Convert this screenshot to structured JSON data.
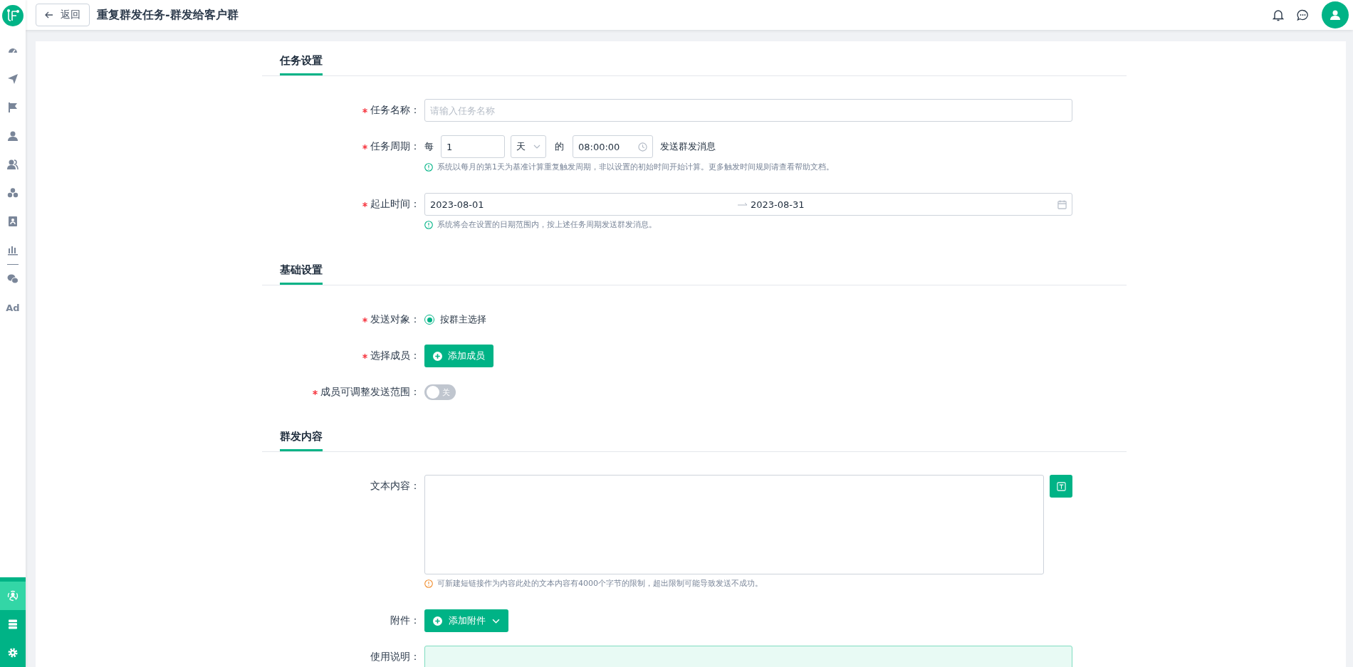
{
  "sidebar": {
    "ad_label": "Ad",
    "bottom_items": [
      {
        "selected": true
      },
      {
        "selected": false
      },
      {
        "selected": false
      }
    ]
  },
  "header": {
    "back_button": "返回",
    "title": "重复群发任务-群发给客户群"
  },
  "sections": [
    {
      "title": "任务设置",
      "fields": [
        {
          "kind": "text",
          "label": "任务名称：",
          "required": true,
          "placeholder": "请输入任务名称"
        },
        {
          "kind": "period",
          "label": "任务周期：",
          "required": true,
          "prefix": "每",
          "count": "1",
          "unit": "天",
          "joiner": "的",
          "time": "08:00:00",
          "suffix": "发送群发消息",
          "hint": {
            "text": "系统以每月的第1天为基准计算重复触发周期，非以设置的初始时间开始计算。更多触发时间规则请查看帮助文档。",
            "kind": "info"
          }
        },
        {
          "kind": "daterange",
          "label": "起止时间：",
          "required": true,
          "start": "2023-08-01",
          "end": "2023-08-31",
          "hint": {
            "text": "系统将会在设置的日期范围内，按上述任务周期发送群发消息。",
            "kind": "info"
          }
        }
      ]
    },
    {
      "title": "基础设置",
      "fields": [
        {
          "kind": "radio",
          "label": "发送对象：",
          "required": true,
          "option": {
            "label": "按群主选择",
            "selected": true
          }
        },
        {
          "kind": "button",
          "label": "选择成员：",
          "required": true,
          "button": "添加成员"
        },
        {
          "kind": "switch",
          "label": "成员可调整发送范围：",
          "required": true,
          "on": false,
          "switch_text": "关"
        }
      ]
    },
    {
      "title": "群发内容",
      "fields": [
        {
          "kind": "textarea",
          "label": "文本内容：",
          "required": false,
          "hint": {
            "text": "可新建短链接作为内容此处的文本内容有4000个字节的限制，超出限制可能导致发送不成功。",
            "kind": "warning"
          }
        },
        {
          "kind": "dropdown_button",
          "label": "附件：",
          "required": false,
          "button": "添加附件"
        },
        {
          "kind": "notice",
          "label": "使用说明：",
          "required": false
        }
      ]
    }
  ]
}
